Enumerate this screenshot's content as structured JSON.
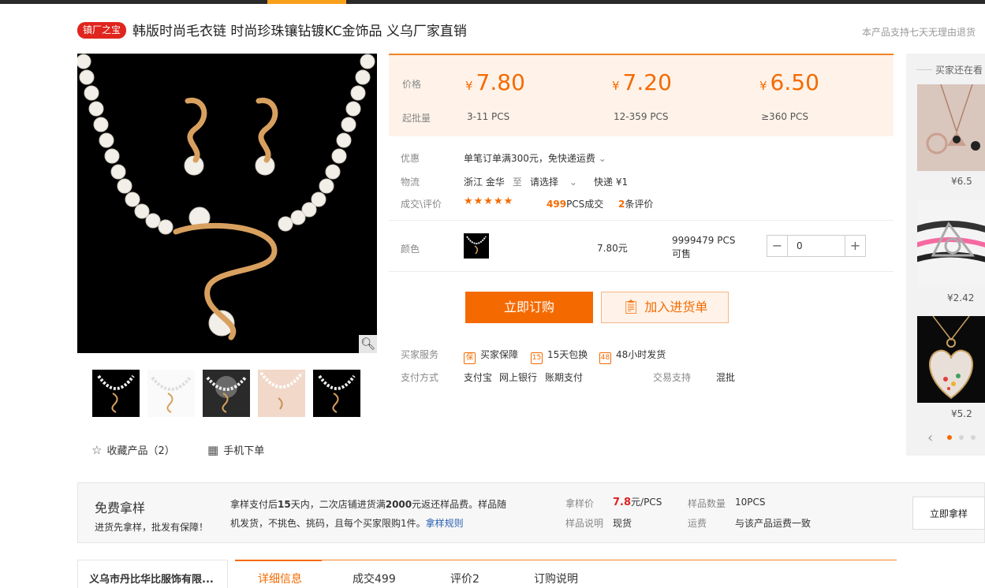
{
  "header": {
    "badge": "镇厂之宝",
    "title": "韩版时尚毛衣链 时尚珍珠镶钻镀KC金饰品 义乌厂家直销",
    "return_note": "本产品支持七天无理由退货"
  },
  "gallery": {
    "zoom_icon": "magnifier-icon",
    "thumbnails": [
      "thumb-1",
      "thumb-2",
      "thumb-3",
      "thumb-4",
      "thumb-5"
    ],
    "favorite_label": "收藏产品（2）",
    "mobile_label": "手机下单"
  },
  "pricing": {
    "price_label": "价格",
    "moq_label": "起批量",
    "currency_symbol": "¥",
    "tiers": [
      {
        "price": "7.80",
        "range": "3-11  PCS"
      },
      {
        "price": "7.20",
        "range": "12-359  PCS"
      },
      {
        "price": "6.50",
        "range": "≥360  PCS"
      }
    ]
  },
  "info": {
    "promo_label": "优惠",
    "promo_value": "单笔订单满300元，免快递运费",
    "logistics_label": "物流",
    "origin": "浙江  金华",
    "to": "至",
    "destination": "请选择",
    "express": "快递  ¥1",
    "deal_label": "成交\\评价",
    "stars": "★★★★★",
    "deal_count": "499",
    "deal_suffix": "PCS成交",
    "review_count": "2",
    "review_suffix": "条评价"
  },
  "color_row": {
    "label": "颜色",
    "price": "7.80元",
    "stock": "9999479 PCS可售",
    "qty_value": "0",
    "minus": "−",
    "plus": "+"
  },
  "actions": {
    "order": "立即订购",
    "cart": "加入进货单"
  },
  "services": {
    "label": "买家服务",
    "items": [
      {
        "icon": "shield-icon",
        "glyph": "保",
        "text": "买家保障"
      },
      {
        "icon": "calendar-15-icon",
        "glyph": "15",
        "text": "15天包换"
      },
      {
        "icon": "clock-48-icon",
        "glyph": "48",
        "text": "48小时发货"
      }
    ],
    "pay_label": "支付方式",
    "pay_methods": [
      "支付宝",
      "网上银行",
      "账期支付"
    ],
    "trade_label": "交易支持",
    "trade_value": "混批"
  },
  "sidebar": {
    "title": "买家还在看",
    "items": [
      {
        "price": "¥6.5"
      },
      {
        "price": "¥2.42"
      },
      {
        "price": "¥5.2"
      }
    ]
  },
  "sample": {
    "title": "免费拿样",
    "subtitle": "进货先拿样，批发有保障！",
    "desc_pre": "拿样支付后",
    "desc_days": "15",
    "desc_mid": "天内，二次店铺进货满",
    "desc_amount": "2000",
    "desc_post": "元返还样品费。样品随机发货，不挑色、挑码，且每个买家限购1件。",
    "rules_link": "拿样规则",
    "price_label": "拿样价",
    "price_value": "7.8",
    "price_unit": "元/PCS",
    "note_label": "样品说明",
    "note_value": "现货",
    "qty_label": "样品数量",
    "qty_value": "10PCS",
    "ship_label": "运费",
    "ship_value": "与该产品运费一致",
    "button": "立即拿样"
  },
  "bottom": {
    "shop_name": "义乌市丹比华比服饰有限...",
    "tabs": [
      "详细信息",
      "成交499",
      "评价2",
      "订购说明"
    ]
  },
  "colors": {
    "accent": "#f56a00",
    "badge": "#e0241e",
    "price_bg": "#fff3e9"
  }
}
